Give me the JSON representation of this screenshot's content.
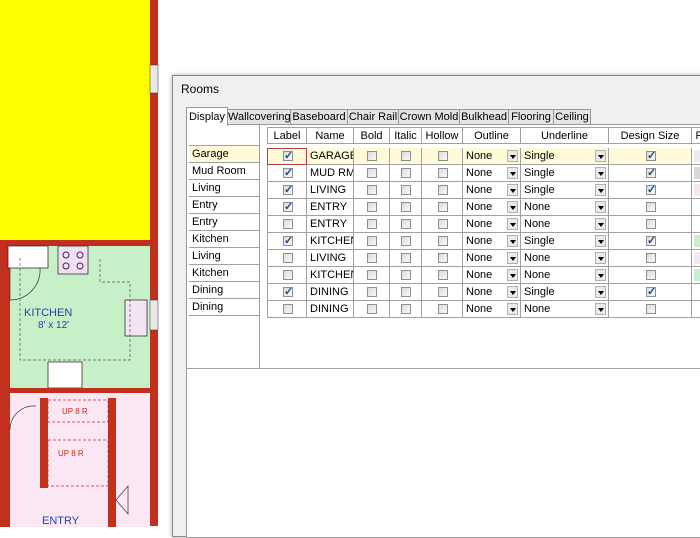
{
  "dialog": {
    "title": "Rooms"
  },
  "tabs": [
    "Display",
    "Wallcovering",
    "Baseboard",
    "Chair Rail",
    "Crown Mold",
    "Bulkhead",
    "Flooring",
    "Ceiling"
  ],
  "columns": [
    "Label",
    "Name",
    "Bold",
    "Italic",
    "Hollow",
    "Outline",
    "Underline",
    "Design Size",
    "Fill"
  ],
  "rows": [
    {
      "room": "Garage",
      "label": true,
      "name": "GARAGE",
      "bold": false,
      "italic": false,
      "hollow": false,
      "outline": "None",
      "underline": "Single",
      "design_size": true,
      "fill": "#eaeef2"
    },
    {
      "room": "Mud Room",
      "label": true,
      "name": "MUD RM",
      "bold": false,
      "italic": false,
      "hollow": false,
      "outline": "None",
      "underline": "Single",
      "design_size": true,
      "fill": "#d8d8d8"
    },
    {
      "room": "Living",
      "label": true,
      "name": "LIVING",
      "bold": false,
      "italic": false,
      "hollow": false,
      "outline": "None",
      "underline": "Single",
      "design_size": true,
      "fill": "#f6e8f2"
    },
    {
      "room": "Entry",
      "label": true,
      "name": "ENTRY",
      "bold": false,
      "italic": false,
      "hollow": false,
      "outline": "None",
      "underline": "None",
      "design_size": false,
      "fill": "#ffffff"
    },
    {
      "room": "Entry",
      "label": false,
      "name": "ENTRY",
      "bold": false,
      "italic": false,
      "hollow": false,
      "outline": "None",
      "underline": "None",
      "design_size": false,
      "fill": "#ffffff"
    },
    {
      "room": "Kitchen",
      "label": true,
      "name": "KITCHEN",
      "bold": false,
      "italic": false,
      "hollow": false,
      "outline": "None",
      "underline": "Single",
      "design_size": true,
      "fill": "#c8f0c8"
    },
    {
      "room": "Living",
      "label": false,
      "name": "LIVING",
      "bold": false,
      "italic": false,
      "hollow": false,
      "outline": "None",
      "underline": "None",
      "design_size": false,
      "fill": "#f6e8f2"
    },
    {
      "room": "Kitchen",
      "label": false,
      "name": "KITCHEN",
      "bold": false,
      "italic": false,
      "hollow": false,
      "outline": "None",
      "underline": "None",
      "design_size": false,
      "fill": "#c8f0c8"
    },
    {
      "room": "Dining",
      "label": true,
      "name": "DINING",
      "bold": false,
      "italic": false,
      "hollow": false,
      "outline": "None",
      "underline": "Single",
      "design_size": true,
      "fill": "#ffffff"
    },
    {
      "room": "Dining",
      "label": false,
      "name": "DINING",
      "bold": false,
      "italic": false,
      "hollow": false,
      "outline": "None",
      "underline": "None",
      "design_size": false,
      "fill": "#ffffff"
    }
  ],
  "plan": {
    "kitchen_label": "KITCHEN",
    "kitchen_dims": "8' x 12'",
    "entry_label": "ENTRY",
    "stair_label_1": "UP 8 R",
    "stair_label_2": "UP 8 R",
    "colors": {
      "garage": "#ffff00",
      "wall": "#c0301c",
      "kitchen": "#c8f0c8",
      "living": "#fbe6f4"
    }
  }
}
